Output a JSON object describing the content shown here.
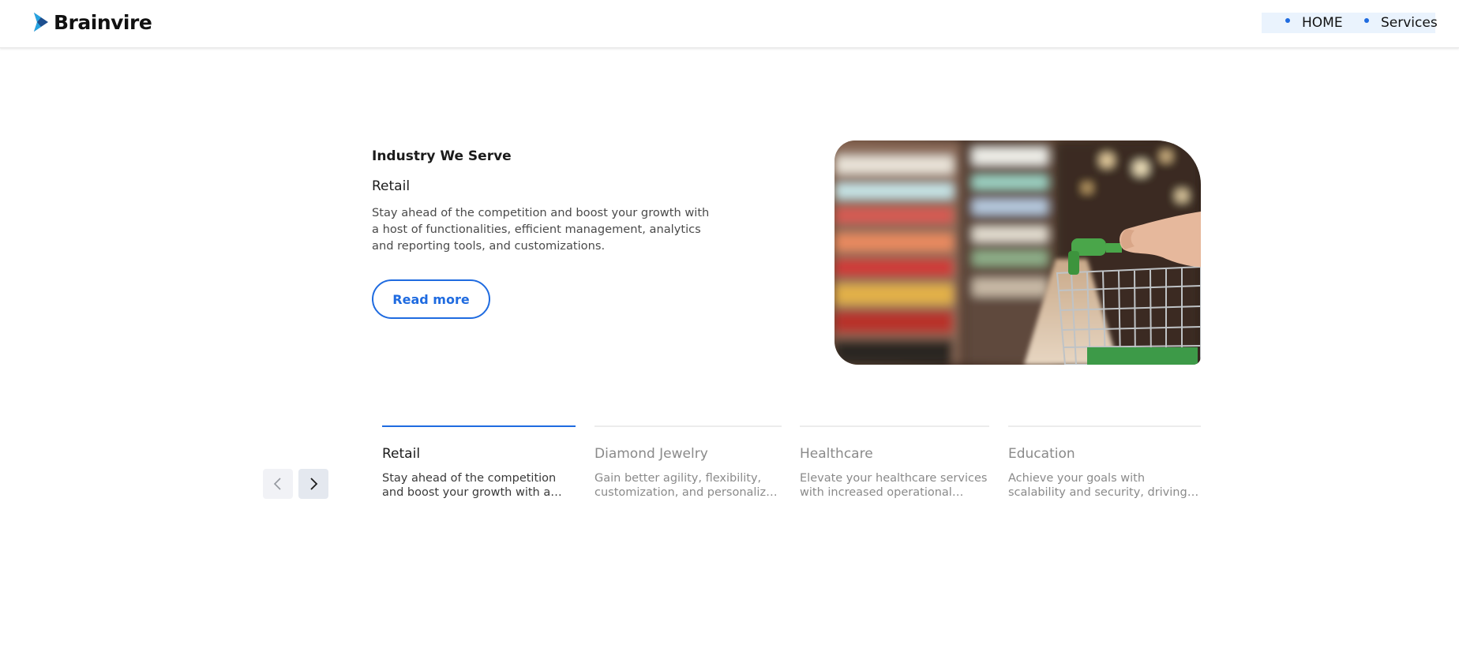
{
  "header": {
    "logo_text": "Brainvire",
    "nav": [
      {
        "label": "HOME"
      },
      {
        "label": "Services"
      }
    ]
  },
  "hero": {
    "eyebrow": "Industry We Serve",
    "title": "Retail",
    "description": "Stay ahead of the competition and boost your growth with a host of functionalities, efficient management, analytics and reporting tools, and customizations.",
    "cta_label": "Read more"
  },
  "carousel": {
    "prev_icon": "chevron-left-icon",
    "next_icon": "chevron-right-icon",
    "active_index": 0,
    "tabs": [
      {
        "title": "Retail",
        "description": "Stay ahead of the competition and boost your growth with a host of functionalities, efficient management, analytics and reporting tools, and customizations."
      },
      {
        "title": "Diamond Jewelry",
        "description": "Gain better agility, flexibility, customization, and personalized experiences for your customers."
      },
      {
        "title": "Healthcare",
        "description": "Elevate your healthcare services with increased operational efficiency and better patient care."
      },
      {
        "title": "Education",
        "description": "Achieve your goals with scalability and security, driving personalized learning experiences."
      }
    ]
  },
  "colors": {
    "accent": "#1f6be0",
    "nav_bg": "#eaf3fd",
    "text_dark": "#1b1b1b",
    "text_muted": "#8a8a8a"
  }
}
